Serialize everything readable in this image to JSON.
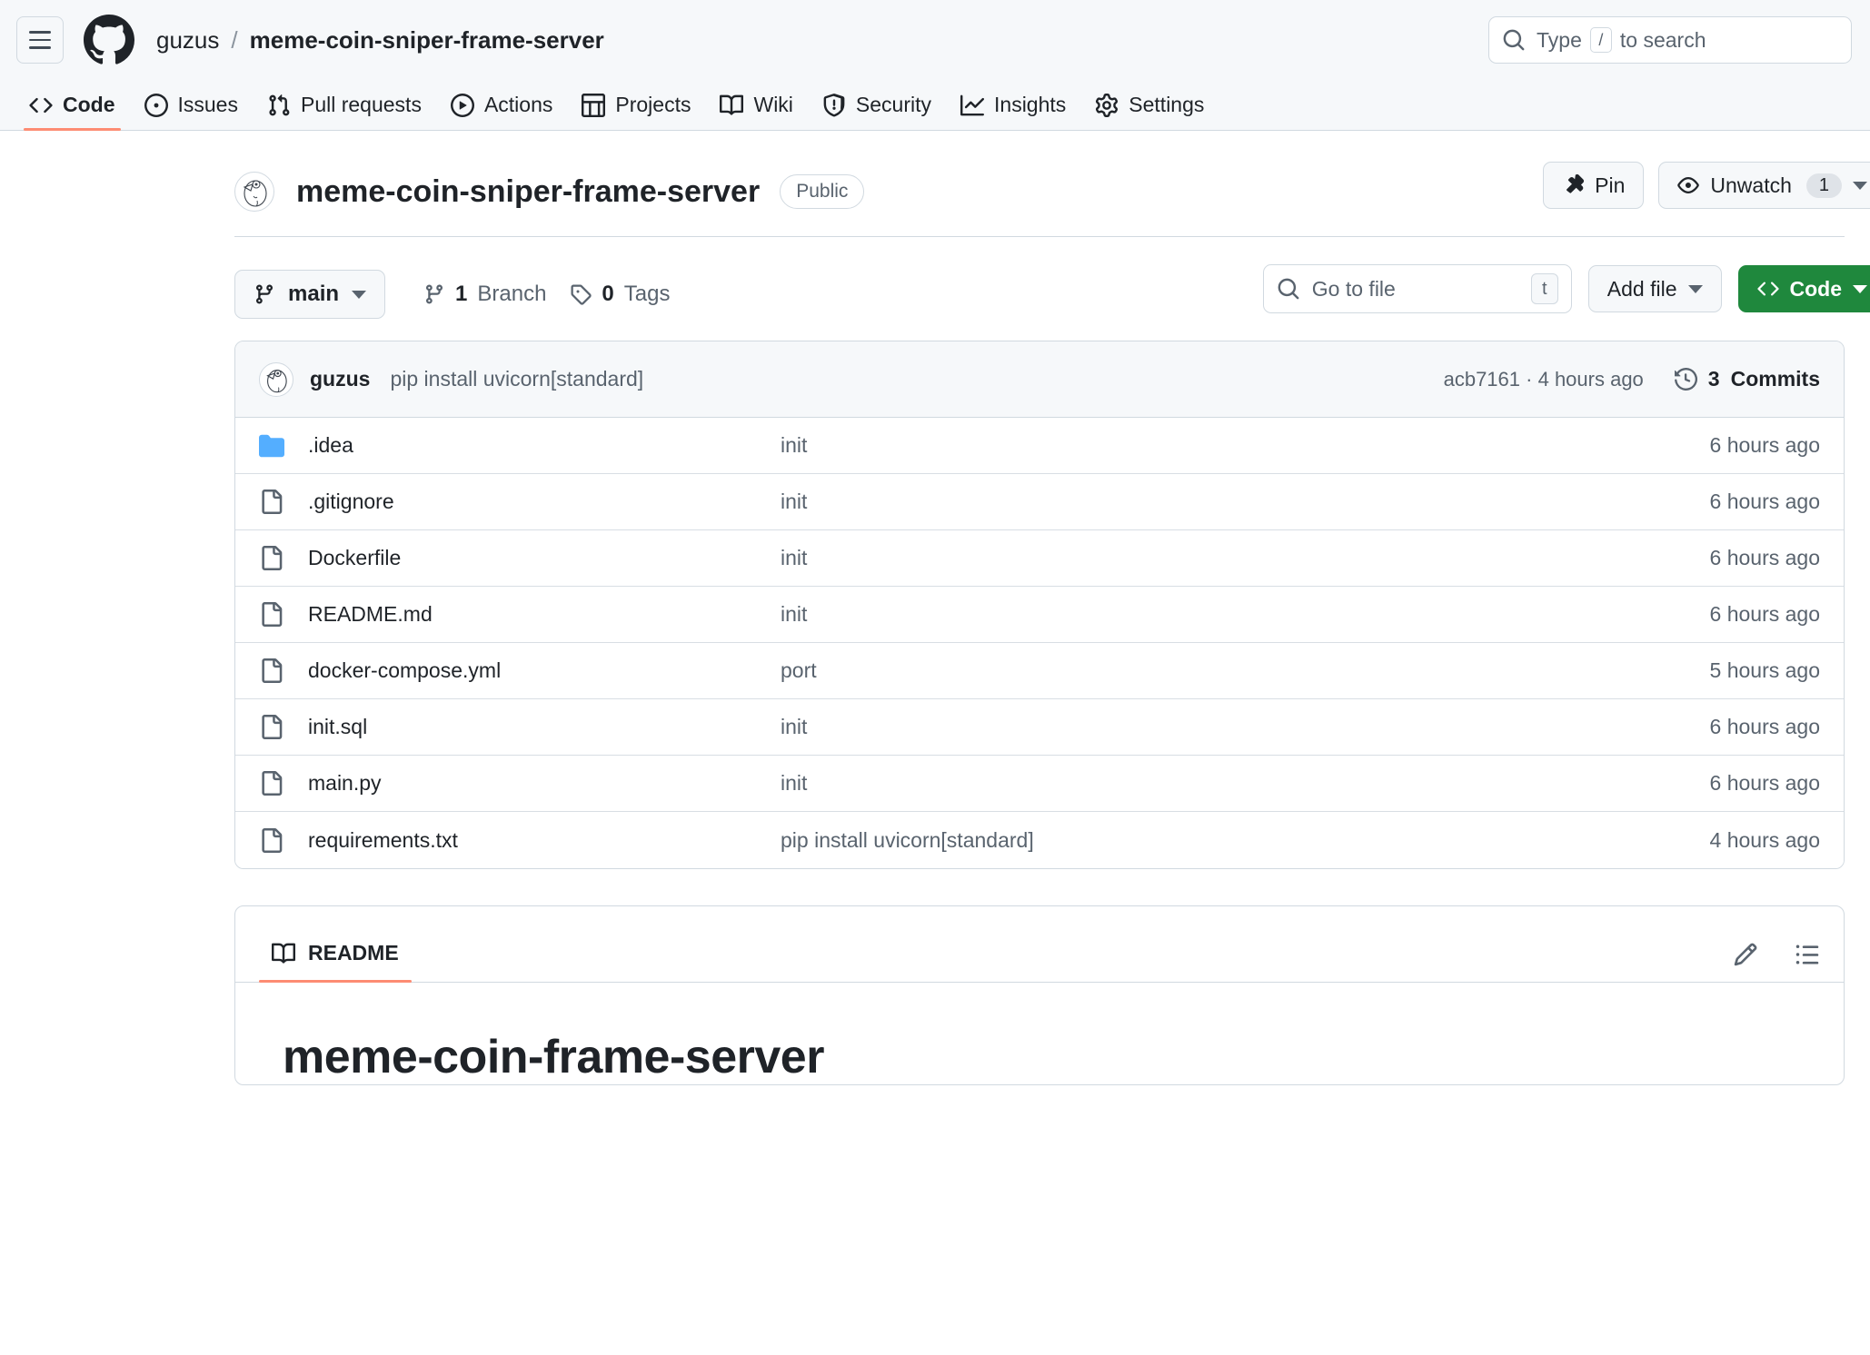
{
  "header": {
    "menu_label": "Open menu",
    "logo_label": "github-logo",
    "breadcrumb": {
      "owner": "guzus",
      "separator": "/",
      "repo": "meme-coin-sniper-frame-server"
    },
    "search": {
      "placeholder": "Type",
      "key_hint": "/",
      "suffix": "to search"
    }
  },
  "nav": {
    "items": [
      {
        "label": "Code",
        "icon": "code-icon",
        "selected": true
      },
      {
        "label": "Issues",
        "icon": "issue-opened-icon",
        "selected": false
      },
      {
        "label": "Pull requests",
        "icon": "git-pull-request-icon",
        "selected": false
      },
      {
        "label": "Actions",
        "icon": "play-icon",
        "selected": false
      },
      {
        "label": "Projects",
        "icon": "table-icon",
        "selected": false
      },
      {
        "label": "Wiki",
        "icon": "book-icon",
        "selected": false
      },
      {
        "label": "Security",
        "icon": "shield-icon",
        "selected": false
      },
      {
        "label": "Insights",
        "icon": "graph-icon",
        "selected": false
      },
      {
        "label": "Settings",
        "icon": "gear-icon",
        "selected": false
      }
    ]
  },
  "repo": {
    "name": "meme-coin-sniper-frame-server",
    "visibility": "Public",
    "pin_label": "Pin",
    "watch_label": "Unwatch",
    "watch_count": "1"
  },
  "toolbar": {
    "branch_name": "main",
    "branch_count": "1",
    "branch_word": "Branch",
    "tag_count": "0",
    "tag_word": "Tags",
    "file_search_placeholder": "Go to file",
    "file_search_key": "t",
    "add_file_label": "Add file",
    "code_label": "Code"
  },
  "commit_bar": {
    "author": "guzus",
    "message": "pip install uvicorn[standard]",
    "hash": "acb7161",
    "relative_time": "4 hours ago",
    "separator": "·",
    "commits_count": "3",
    "commits_word": "Commits"
  },
  "files": [
    {
      "name": ".idea",
      "type": "folder",
      "message": "init",
      "time": "6 hours ago"
    },
    {
      "name": ".gitignore",
      "type": "file",
      "message": "init",
      "time": "6 hours ago"
    },
    {
      "name": "Dockerfile",
      "type": "file",
      "message": "init",
      "time": "6 hours ago"
    },
    {
      "name": "README.md",
      "type": "file",
      "message": "init",
      "time": "6 hours ago"
    },
    {
      "name": "docker-compose.yml",
      "type": "file",
      "message": "port",
      "time": "5 hours ago"
    },
    {
      "name": "init.sql",
      "type": "file",
      "message": "init",
      "time": "6 hours ago"
    },
    {
      "name": "main.py",
      "type": "file",
      "message": "init",
      "time": "6 hours ago"
    },
    {
      "name": "requirements.txt",
      "type": "file",
      "message": "pip install uvicorn[standard]",
      "time": "4 hours ago"
    }
  ],
  "readme": {
    "tab_label": "README",
    "edit_label": "Edit file",
    "outline_label": "Outline",
    "heading": "meme-coin-frame-server"
  },
  "colors": {
    "accent_green": "#1f883d",
    "tab_underline": "#fd8c73",
    "folder_blue": "#54aeff",
    "muted_text": "#59636e",
    "border": "#d1d9e0",
    "header_bg": "#f6f8fa"
  }
}
